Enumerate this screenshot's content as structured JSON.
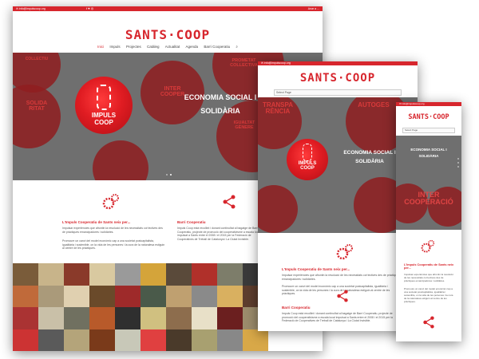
{
  "desktop": {
    "topbar_left": "✉ info@impulscoop.org",
    "topbar_right": "Anar a ...",
    "logo": "SANTS·COOP",
    "menu": [
      "Inici",
      "Impuls",
      "Projectes",
      "Catàleg",
      "Actualitat",
      "Agenda",
      "Barri Cooperatiu"
    ],
    "hero_badge_line1": "IMPULS",
    "hero_badge_line2": "COOP",
    "hero_title_line1": "ECONOMIA SOCIAL I",
    "hero_title_line2": "SOLIDÀRIA",
    "gear_words": [
      "SOLIDA RITAT",
      "INTER COOPER",
      "PROMETAT COLLECTIVA",
      "IGUALTAT GÈNERE",
      "COLLECTIU"
    ],
    "section1_title": "L'Impuls Cooperatiu de Sants neix per...",
    "section1_text": "Impulsar experiències que afrontin la resolució de les necessitats col·lectives des de pràctiques emancipadores i solidàries.",
    "section1_text2": "Promoure un canvi del model econòmic cap a una societat postcapitalista, igualitària i sostenible, on la vida de les persones i la cura de la naturalesa estiguin al centre de les pràctiques.",
    "section2_title": "Barri Cooperatiu",
    "section2_text": "Impuls Coop està recollint i donant continuïtat al bagatge de Barri Cooperatiu, projecte de promoció del cooperativisme a escala local impulsat a Sants entre el 2008 i el 2015 per la Federació de Cooperatives de Treball de Catalunya i La Ciutat Invisible."
  },
  "tablet": {
    "topbar_left": "✉ info@impulscoop.org",
    "logo": "SANTS·COOP",
    "select_label": "Select Page",
    "gear_words": [
      "TRANSPA RÈNCIA",
      "AUTOGES"
    ],
    "hero_badge_line1": "IMPULS",
    "hero_badge_line2": "COOP",
    "hero_title_line1": "ECONOMIA SOCIAL I",
    "hero_title_line2": "SOLIDÀRIA",
    "section1_title": "L'Impuls Cooperatiu de Sants neix per...",
    "section1_text": "Impulsar experiències que afrontin la resolució de les necessitats col·lectives des de pràctiques emancipadores i solidàries.",
    "section1_text2": "Promoure un canvi del model econòmic cap a una societat postcapitalista, igualitària i sostenible, on la vida de les persones i la cura de la naturalesa estiguin al centre de les pràctiques.",
    "section2_title": "Barri Cooperatiu",
    "section2_text": "Impuls Coop està recollint i donant continuïtat al bagatge de Barri Cooperatiu, projecte de promoció del cooperativisme a escala local impulsat a Sants entre el 2008 i el 2015 per la Federació de Cooperatives de Treball de Catalunya i La Ciutat Invisible."
  },
  "mobile": {
    "topbar_left": "✉ info@impulscoop.org",
    "logo": "SANTS·COOP",
    "select_label": "Select Page",
    "hero_title_line1": "ECONOMIA SOCIAL I",
    "hero_title_line2": "SOLIDÀRIA",
    "gear_word": "INTER COOPERACIÓ",
    "section1_title": "L'Impuls Cooperatiu de Sants neix per...",
    "section1_text": "Impulsar experiències que afrontin la resolució de les necessitats col·lectives des de pràctiques emancipadores i solidàries.",
    "section1_text2": "Promoure un canvi del model econòmic cap a una societat postcapitalista, igualitària i sostenible, on la vida de les persones i la cura de la naturalesa estiguin al centre de les pràctiques."
  },
  "colors": {
    "brand_red": "#d7262d",
    "hero_gray": "#6f6f6f",
    "gear_dark_red": "#8f1d20"
  },
  "photo_colors": [
    "#7a5c3a",
    "#c8b48a",
    "#8a3a2a",
    "#d9c9a0",
    "#9a9a9a",
    "#d4a43a",
    "#5a4a3a",
    "#b0302a",
    "#7d7d6a",
    "#3a3a3a",
    "#c06a3a",
    "#aa9a7a",
    "#e0d0b0",
    "#6a4a2a",
    "#9e2a2a",
    "#4a5a4a",
    "#bfa070",
    "#8a8a8a",
    "#d9b060",
    "#5e3e2e",
    "#a33",
    "#c9c0a8",
    "#707060",
    "#b85a2a",
    "#2f2f2f",
    "#d0c080",
    "#8d6d4d",
    "#e8e0c8",
    "#6b1f1f",
    "#9c8c6c",
    "#cc3333",
    "#5a5a5a",
    "#b4a47a",
    "#7a3a1a",
    "#c8c8b8",
    "#e04040",
    "#4a3a2a",
    "#a8a070",
    "#888",
    "#d8a848"
  ]
}
